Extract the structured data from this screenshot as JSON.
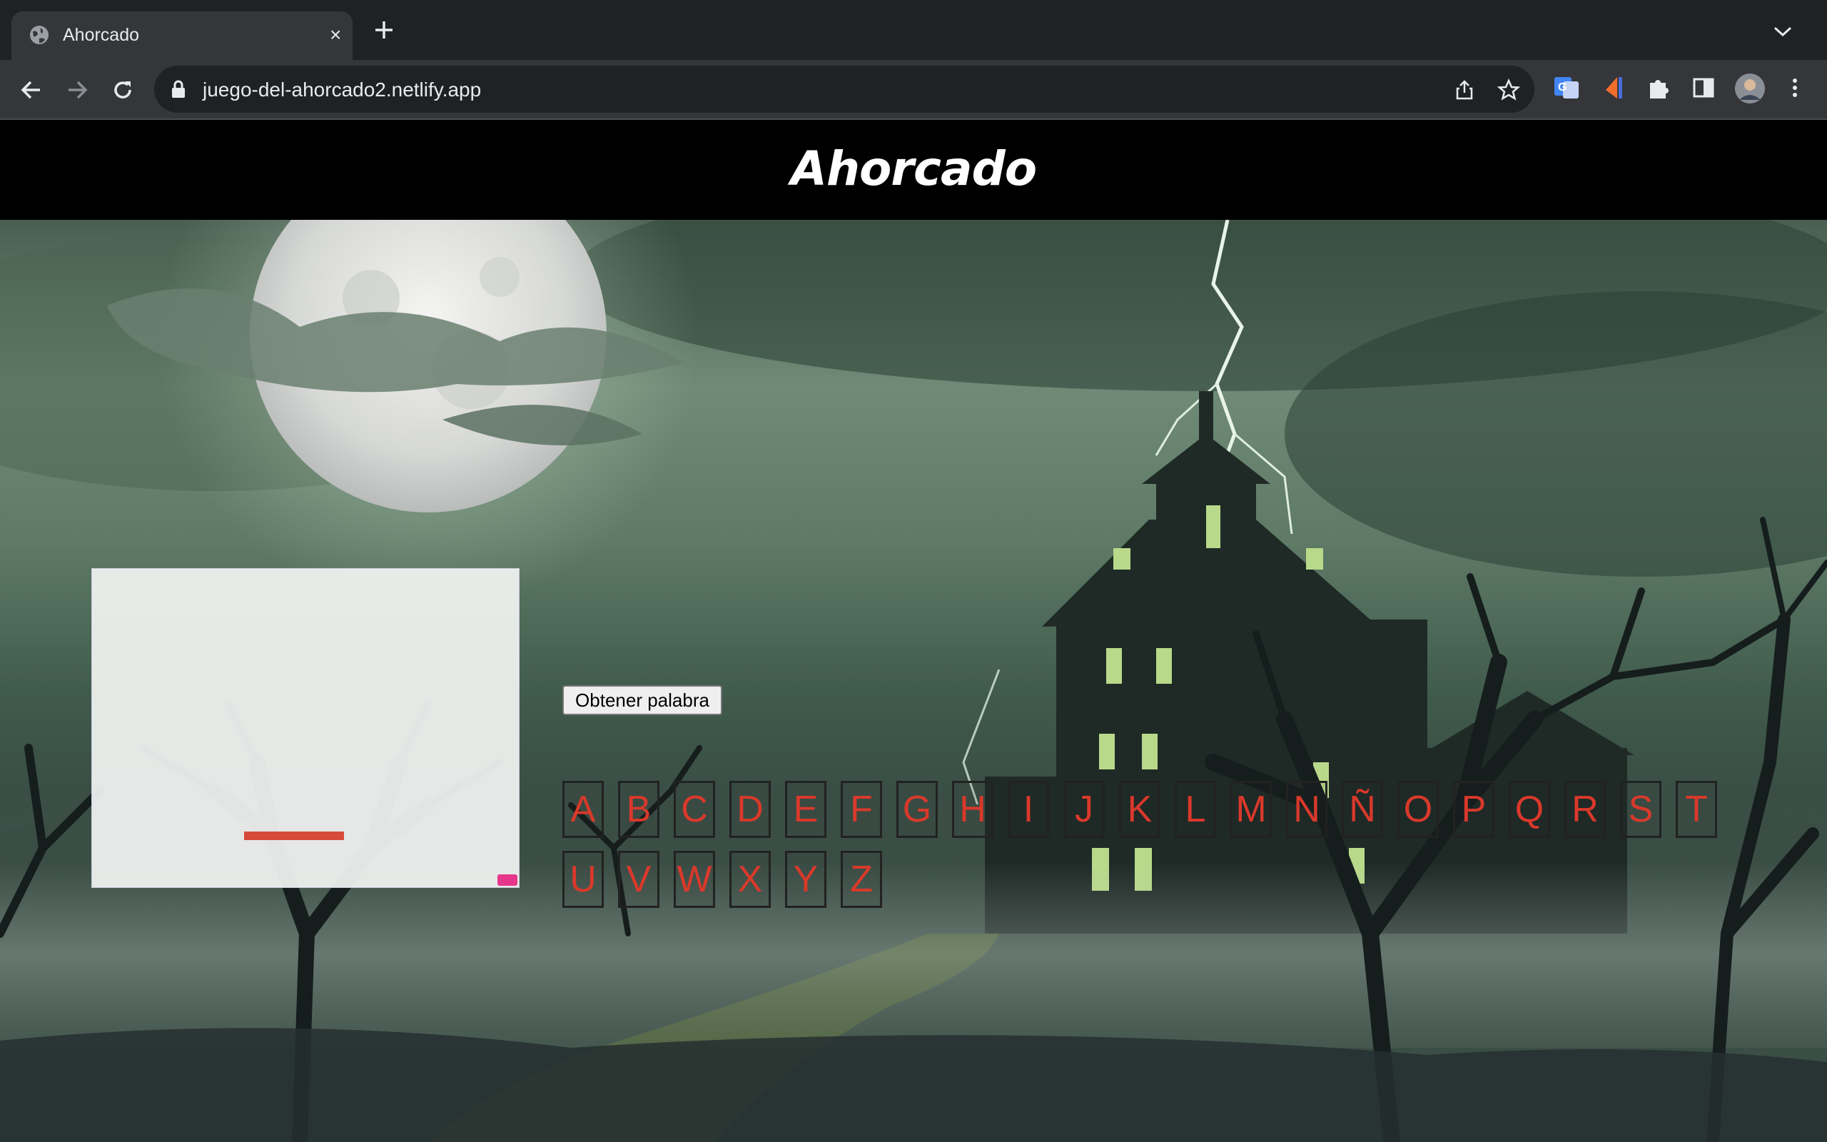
{
  "browser": {
    "tab_title": "Ahorcado",
    "tab_close": "×",
    "url": "juego-del-ahorcado2.netlify.app"
  },
  "page": {
    "title": "Ahorcado",
    "get_word_button": "Obtener palabra",
    "keyboard_row1": [
      "A",
      "B",
      "C",
      "D",
      "E",
      "F",
      "G",
      "H",
      "I",
      "J",
      "K",
      "L",
      "M",
      "N",
      "Ñ",
      "O",
      "P",
      "Q",
      "R",
      "S",
      "T"
    ],
    "keyboard_row2": [
      "U",
      "V",
      "W",
      "X",
      "Y",
      "Z"
    ],
    "letter_color": "#d9392b",
    "word_slot_color": "#d64a3a"
  },
  "icons": {
    "tab": "globe-icon",
    "new_tab": "plus-icon",
    "tab_list": "chevron-down-icon",
    "back": "arrow-left-icon",
    "forward": "arrow-right-icon",
    "reload": "reload-icon",
    "lock": "lock-icon",
    "share": "share-icon",
    "bookmark": "star-icon",
    "extensions": [
      "google-translate-icon",
      "extension-flag-icon",
      "puzzle-icon",
      "side-panel-icon",
      "avatar",
      "kebab-menu-icon"
    ]
  }
}
